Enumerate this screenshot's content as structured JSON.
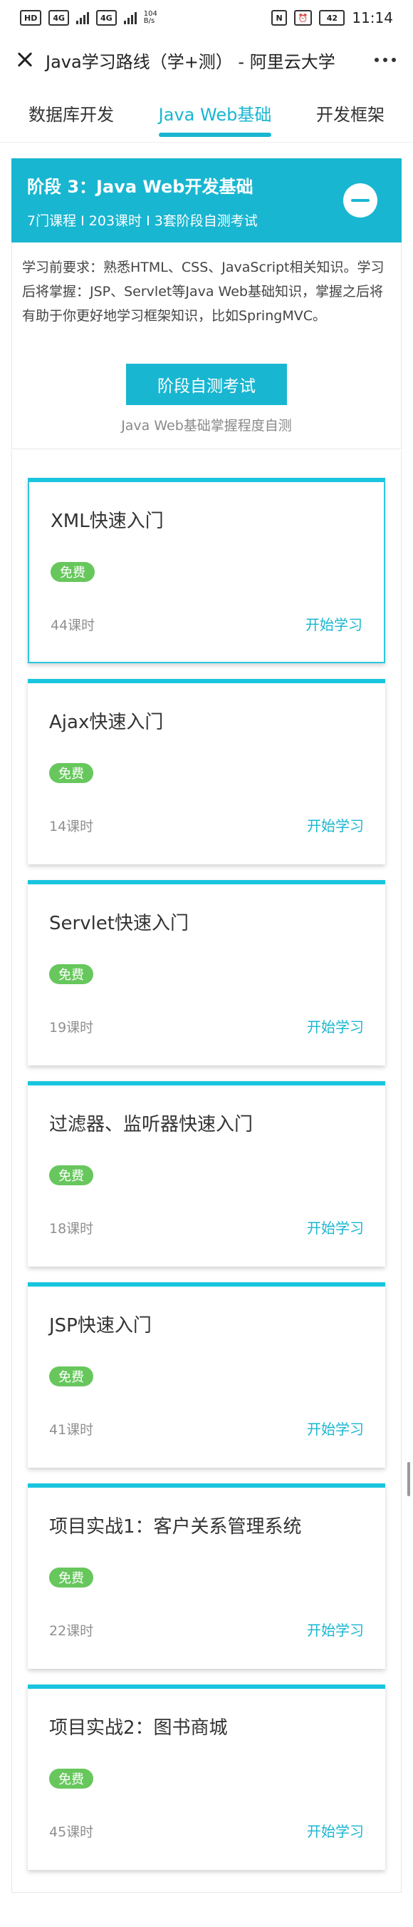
{
  "status_bar": {
    "left_chip_1": "HD",
    "left_chip_2": "4G",
    "left_chip_3": "4G",
    "speed_top": "104",
    "speed_bottom": "B/s",
    "battery": "42",
    "time": "11:14"
  },
  "title_bar": {
    "title": "Java学习路线（学+测） - 阿里云大学"
  },
  "tabs": [
    {
      "label": "数据库开发"
    },
    {
      "label": "Java Web基础"
    },
    {
      "label": "开发框架"
    }
  ],
  "stage": {
    "title": "阶段 3：Java Web开发基础",
    "meta": "7门课程 I 203课时 I 3套阶段自测考试",
    "description": "学习前要求：熟悉HTML、CSS、JavaScript相关知识。学习后将掌握：JSP、Servlet等Java Web基础知识，掌握之后将有助于你更好地学习框架知识，比如SpringMVC。",
    "exam_button": "阶段自测考试",
    "exam_caption": "Java Web基础掌握程度自测"
  },
  "courses": [
    {
      "title": "XML快速入门",
      "badge": "免费",
      "lessons": "44课时",
      "action": "开始学习"
    },
    {
      "title": "Ajax快速入门",
      "badge": "免费",
      "lessons": "14课时",
      "action": "开始学习"
    },
    {
      "title": "Servlet快速入门",
      "badge": "免费",
      "lessons": "19课时",
      "action": "开始学习"
    },
    {
      "title": "过滤器、监听器快速入门",
      "badge": "免费",
      "lessons": "18课时",
      "action": "开始学习"
    },
    {
      "title": "JSP快速入门",
      "badge": "免费",
      "lessons": "41课时",
      "action": "开始学习"
    },
    {
      "title": "项目实战1：客户关系管理系统",
      "badge": "免费",
      "lessons": "22课时",
      "action": "开始学习"
    },
    {
      "title": "项目实战2：图书商城",
      "badge": "免费",
      "lessons": "45课时",
      "action": "开始学习"
    }
  ],
  "colors": {
    "accent": "#19b6d1",
    "badge": "#67c75d"
  },
  "icons": {
    "close": "close-icon",
    "more": "more-icon",
    "collapse": "minus-circle-icon"
  }
}
